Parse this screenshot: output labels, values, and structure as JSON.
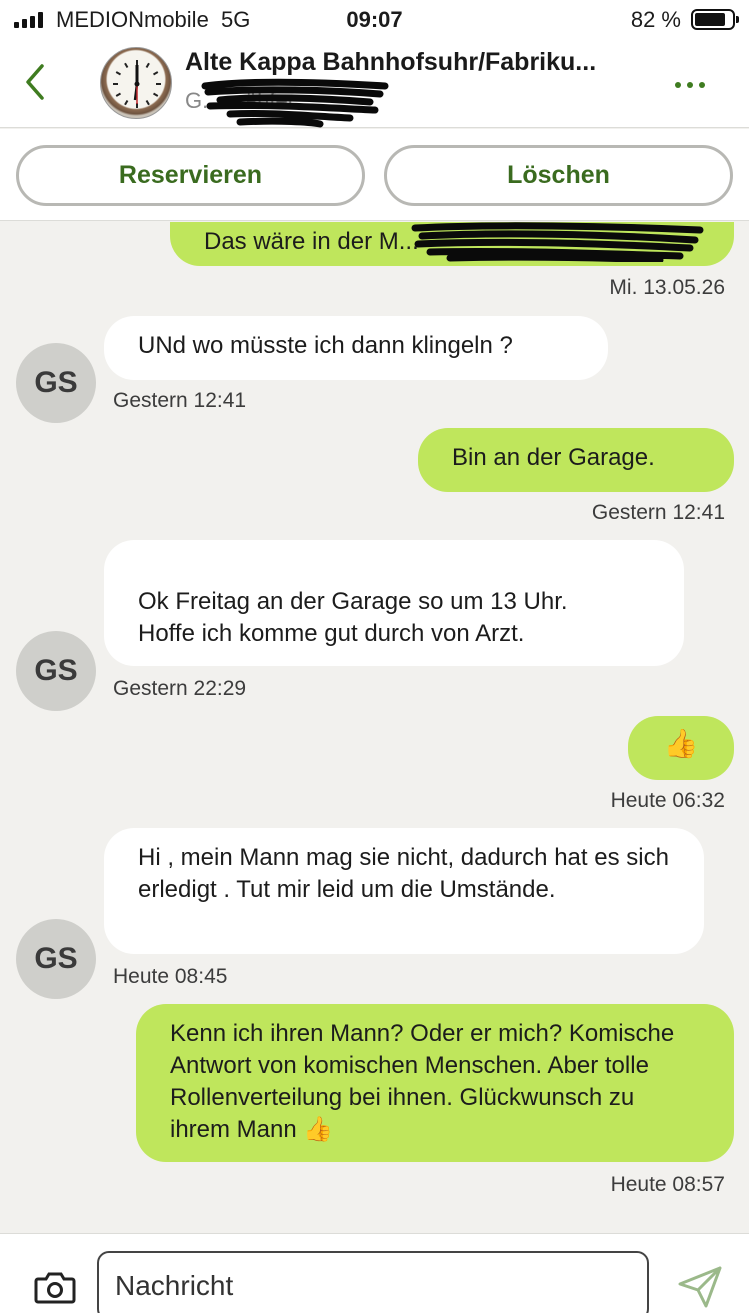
{
  "status": {
    "carrier": "MEDIONmobile",
    "network": "5G",
    "time": "09:07",
    "battery": "82 %",
    "battery_level_percent": 82
  },
  "header": {
    "title": "Alte Kappa Bahnhofsuhr/Fabriku...",
    "subtitle": "G... ...ähfer",
    "accent_color": "#3f7c20"
  },
  "actions": {
    "reserve_label": "Reservieren",
    "delete_label": "Löschen"
  },
  "messages": [
    {
      "side": "out",
      "text": "Das wäre in der M...",
      "time": "Mi. 13.05.26"
    },
    {
      "side": "in",
      "avatar": "GS",
      "text": "UNd wo müsste ich dann klingeln ?",
      "time": "Gestern 12:41"
    },
    {
      "side": "out",
      "text": "Bin an der Garage.",
      "time": "Gestern 12:41"
    },
    {
      "side": "in",
      "avatar": "GS",
      "text": "Ok Freitag an der Garage so um 13 Uhr.\nHoffe ich komme gut durch von Arzt.",
      "time": "Gestern 22:29"
    },
    {
      "side": "out",
      "text": "👍",
      "time": "Heute 06:32"
    },
    {
      "side": "in",
      "avatar": "GS",
      "text": "Hi , mein Mann mag sie nicht, dadurch hat es sich erledigt . Tut mir leid um die Umstände.",
      "time": "Heute 08:45"
    },
    {
      "side": "out",
      "text": "Kenn ich ihren Mann? Oder er mich? Komische Antwort von komischen Menschen. Aber tolle Rollenverteilung bei ihnen. Glückwunsch zu ihrem Mann 👍",
      "time": "Heute 08:57"
    }
  ],
  "composer": {
    "placeholder": "Nachricht"
  },
  "colors": {
    "outgoing_bubble": "#bfe65c",
    "incoming_bubble": "#ffffff",
    "background": "#f2f1ee"
  }
}
